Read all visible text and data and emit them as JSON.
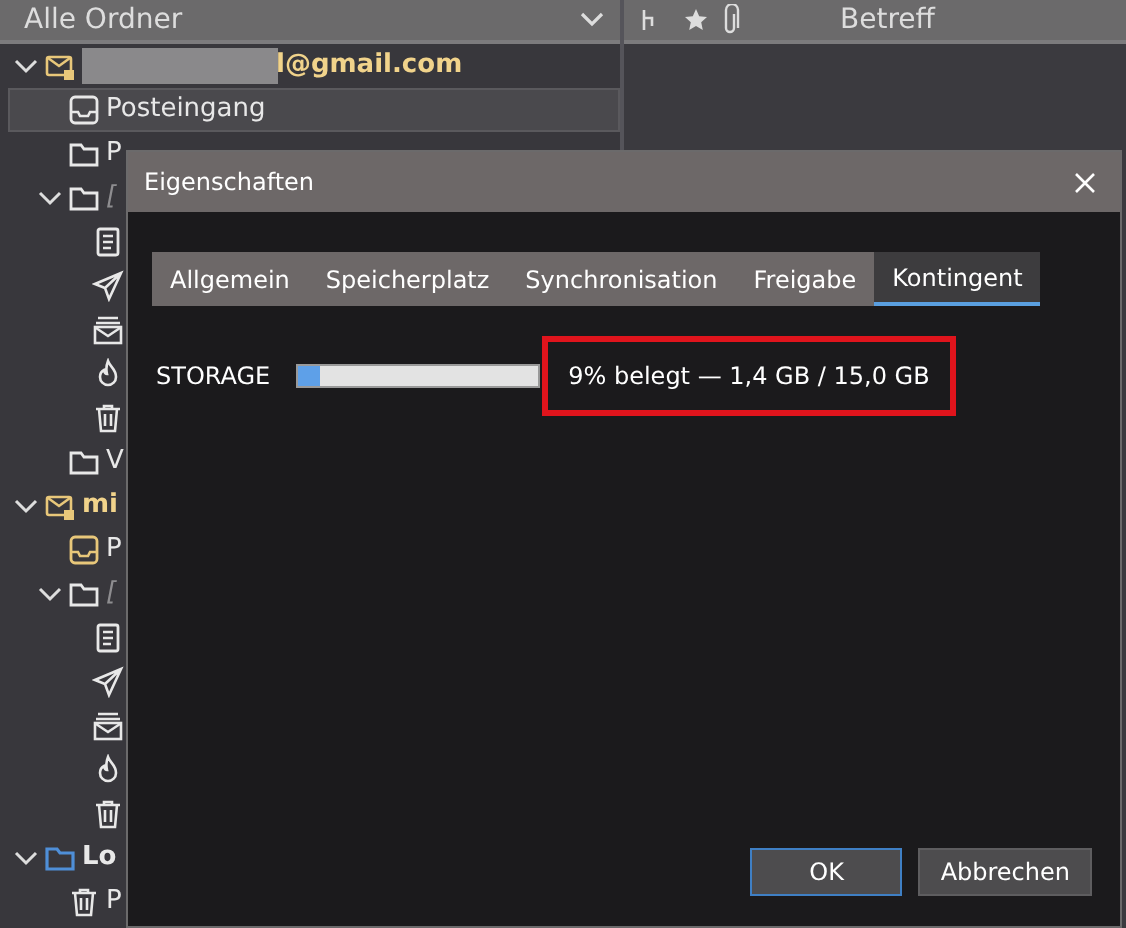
{
  "folder_pane": {
    "header": "Alle Ordner"
  },
  "message_list": {
    "columns": [
      "Betreff"
    ]
  },
  "tree": [
    {
      "kind": "account",
      "text": "l@gmail.com",
      "redacted": true,
      "expanded": true,
      "selected": false,
      "children": [
        {
          "kind": "inbox",
          "text": "Posteingang",
          "selected": true
        },
        {
          "kind": "folder",
          "text": "P",
          "selected": false
        },
        {
          "kind": "folder",
          "text": "[",
          "italic": true,
          "expanded": true,
          "selected": false,
          "children": [
            {
              "kind": "drafts",
              "selected": false
            },
            {
              "kind": "sent",
              "selected": false
            },
            {
              "kind": "archive",
              "selected": false
            },
            {
              "kind": "junk",
              "selected": false
            },
            {
              "kind": "trash",
              "selected": false
            }
          ]
        },
        {
          "kind": "folder",
          "text": "V",
          "selected": false
        }
      ]
    },
    {
      "kind": "account",
      "text": "mi",
      "expanded": true,
      "selected": false,
      "children": [
        {
          "kind": "inbox",
          "text": "P",
          "selected": false
        },
        {
          "kind": "folder",
          "text": "[",
          "italic": true,
          "expanded": true,
          "selected": false,
          "children": [
            {
              "kind": "drafts",
              "selected": false
            },
            {
              "kind": "sent",
              "selected": false
            },
            {
              "kind": "archive",
              "selected": false
            },
            {
              "kind": "junk",
              "selected": false
            },
            {
              "kind": "trash",
              "selected": false
            }
          ]
        }
      ]
    },
    {
      "kind": "local",
      "text": "Lo",
      "expanded": true,
      "selected": false,
      "children": [
        {
          "kind": "trash",
          "text": "P",
          "selected": false
        }
      ]
    }
  ],
  "dialog": {
    "title": "Eigenschaften",
    "tabs": [
      {
        "label": "Allgemein",
        "selected": false
      },
      {
        "label": "Speicherplatz",
        "selected": false
      },
      {
        "label": "Synchronisation",
        "selected": false
      },
      {
        "label": "Freigabe",
        "selected": false
      },
      {
        "label": "Kontingent",
        "selected": true
      }
    ],
    "quota": {
      "label": "STORAGE",
      "level": 0.09,
      "reading": "9% belegt — 1,4 GB / 15,0 GB",
      "highlighted": true
    },
    "buttons": [
      {
        "label": "OK",
        "default": true
      },
      {
        "label": "Abbrechen",
        "default": false
      }
    ]
  }
}
